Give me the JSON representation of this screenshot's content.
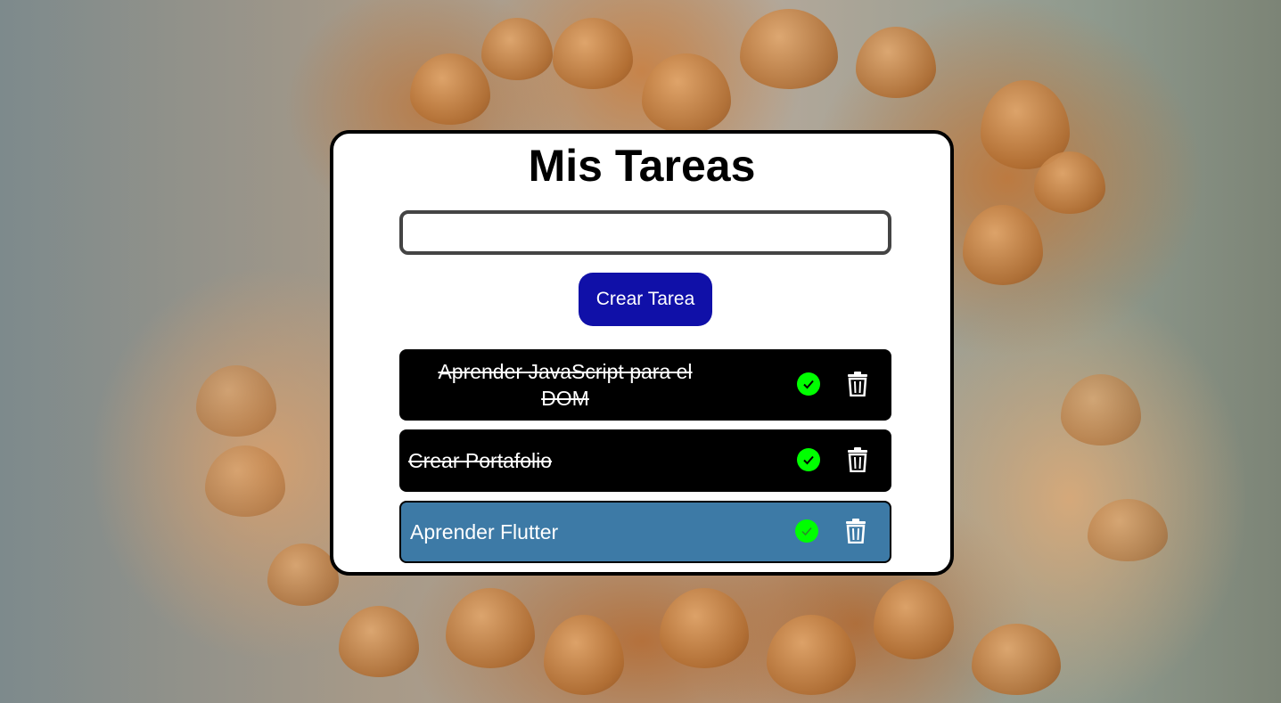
{
  "app": {
    "title": "Mis Tareas"
  },
  "form": {
    "input_value": "",
    "input_placeholder": "",
    "create_button_label": "Crear Tarea"
  },
  "tasks": [
    {
      "text": "Aprender JavaScript para el DOM",
      "completed": true
    },
    {
      "text": "Crear Portafolio",
      "completed": true
    },
    {
      "text": "Aprender Flutter",
      "completed": false
    }
  ],
  "icons": {
    "complete": "check-circle-icon",
    "delete": "trash-icon"
  },
  "colors": {
    "card_background": "#ffffff",
    "create_button": "#1010a8",
    "task_done_background": "#000000",
    "task_active_background": "#3d7aa6",
    "check_icon": "#00ff00"
  }
}
